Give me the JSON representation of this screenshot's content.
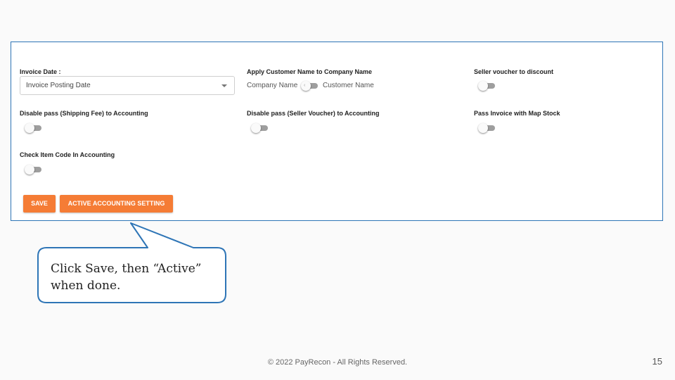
{
  "form": {
    "invoice_date_label": "Invoice Date :",
    "invoice_date_value": "Invoice Posting Date",
    "apply_customer_label": "Apply Customer Name to Company Name",
    "company_name_text": "Company Name",
    "customer_name_text": "Customer Name",
    "seller_voucher_label": "Seller voucher to discount",
    "disable_shipping_label": "Disable pass (Shipping Fee) to Accounting",
    "disable_voucher_label": "Disable pass (Seller Voucher) to Accounting",
    "pass_invoice_label": "Pass Invoice with Map Stock",
    "check_item_label": "Check Item Code In Accounting"
  },
  "buttons": {
    "save": "SAVE",
    "active": "ACTIVE ACCOUNTING SETTING"
  },
  "callout": {
    "text": "Click Save, then “Active” when done."
  },
  "footer": {
    "copyright": "© 2022 PayRecon - All Rights Reserved.",
    "page_number": "15"
  },
  "colors": {
    "accent_orange": "#f57c35",
    "border_blue": "#2e75b6",
    "toggle_off": "#9e9e9e"
  }
}
